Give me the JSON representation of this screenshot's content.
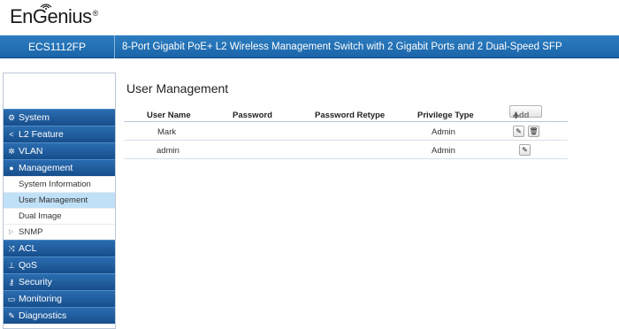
{
  "brand": {
    "name": "EnGenius",
    "trademark": "®"
  },
  "header": {
    "model": "ECS1112FP",
    "description": "8-Port Gigabit PoE+ L2 Wireless Management Switch with 2 Gigabit Ports and 2 Dual-Speed SFP"
  },
  "sidebar": {
    "items": [
      {
        "label": "System",
        "icon": "gear-icon"
      },
      {
        "label": "L2 Feature",
        "icon": "share-icon"
      },
      {
        "label": "VLAN",
        "icon": "cog-cluster-icon"
      },
      {
        "label": "Management",
        "icon": "user-icon"
      }
    ],
    "sub_items": [
      {
        "label": "System Information"
      },
      {
        "label": "User Management",
        "active": true
      },
      {
        "label": "Dual Image"
      },
      {
        "label": "SNMP",
        "expandable": true
      }
    ],
    "items_after": [
      {
        "label": "ACL",
        "icon": "shuffle-icon"
      },
      {
        "label": "QoS",
        "icon": "hierarchy-icon"
      },
      {
        "label": "Security",
        "icon": "key-icon"
      },
      {
        "label": "Monitoring",
        "icon": "monitor-icon"
      },
      {
        "label": "Diagnostics",
        "icon": "wrench-icon"
      }
    ]
  },
  "main": {
    "title": "User Management",
    "columns": [
      "User Name",
      "Password",
      "Password Retype",
      "Privilege Type"
    ],
    "add_label": "Add",
    "rows": [
      {
        "user_name": "Mark",
        "privilege": "Admin",
        "actions": [
          "edit",
          "delete"
        ]
      },
      {
        "user_name": "admin",
        "privilege": "Admin",
        "actions": [
          "edit"
        ]
      }
    ]
  }
}
